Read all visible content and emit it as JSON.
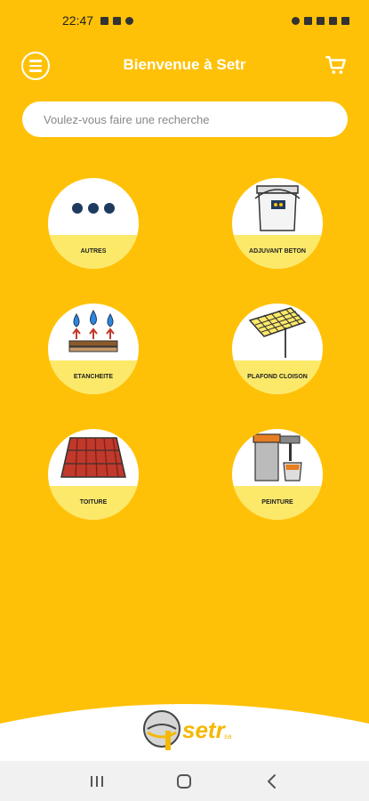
{
  "status_bar": {
    "time": "22:47"
  },
  "header": {
    "title": "Bienvenue à Setr"
  },
  "search": {
    "placeholder": "Voulez-vous faire une recherche"
  },
  "categories": [
    {
      "label": "AUTRES",
      "icon": "more-dots-icon"
    },
    {
      "label": "ADJUVANT BETON",
      "icon": "paint-bucket-icon"
    },
    {
      "label": "ETANCHEITE",
      "icon": "waterproofing-icon"
    },
    {
      "label": "PLAFOND CLOISON",
      "icon": "ceiling-frame-icon"
    },
    {
      "label": "TOITURE",
      "icon": "roof-tiles-icon"
    },
    {
      "label": "PEINTURE",
      "icon": "paint-tools-icon"
    }
  ],
  "footer": {
    "brand": "setr",
    "brand_suffix": "sa"
  },
  "colors": {
    "background": "#FFC107",
    "band": "#FCE96A",
    "white": "#FFFFFF"
  }
}
